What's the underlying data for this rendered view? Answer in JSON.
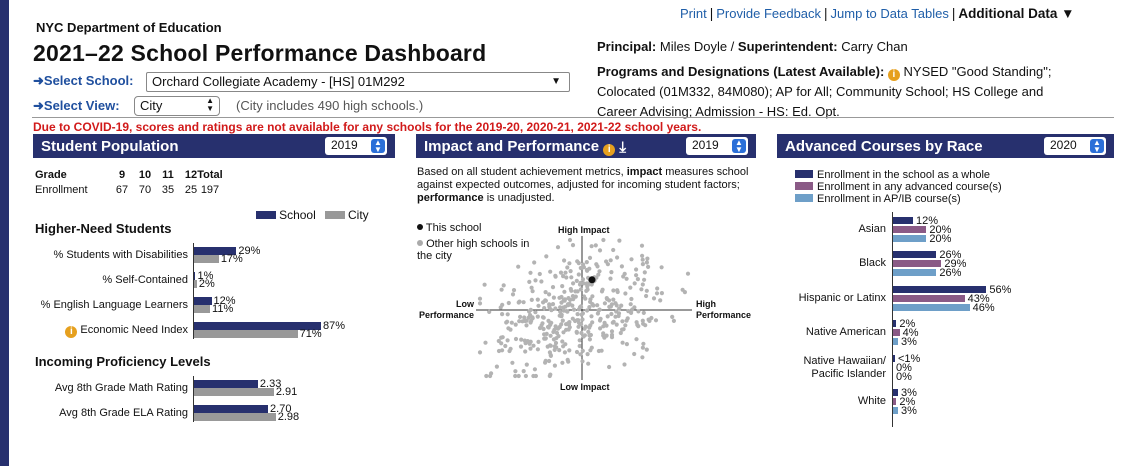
{
  "header": {
    "dept": "NYC Department of Education",
    "title": "2021–22 School Performance Dashboard",
    "links": [
      "Print",
      "Provide Feedback",
      "Jump to Data Tables"
    ],
    "additional_data": "Additional Data ▼",
    "select_school_label": "➜Select School:",
    "select_school_value": "Orchard Collegiate Academy - [HS] 01M292",
    "select_view_label": "➜Select View:",
    "select_view_value": "City",
    "city_note": "(City includes 490 high schools.)",
    "principal_label": "Principal:",
    "principal_value": "Miles Doyle",
    "superintendent_label": "Superintendent:",
    "superintendent_value": "Carry Chan",
    "programs_label": "Programs and Designations (Latest Available):",
    "programs_line1": "NYSED \"Good Standing\";",
    "programs_line2": "Colocated (01M332, 84M080); AP for All; Community School; HS College and",
    "programs_line3": "Career Advising; Admission - HS: Ed. Opt.",
    "covid_notice": "Due to COVID-19, scores and ratings are not available for any schools for the 2019-20, 2020-21, 2021-22 school years.",
    "icon_info": "info-icon",
    "icon_download": "download-icon"
  },
  "student_population": {
    "title": "Student Population",
    "year": "2019",
    "grade_label": "Grade",
    "grades": [
      "9",
      "10",
      "11",
      "12",
      "Total"
    ],
    "enroll_label": "Enrollment",
    "enrollment": [
      "67",
      "70",
      "35",
      "25",
      "197"
    ],
    "legend_school": "School",
    "legend_city": "City",
    "higher_need_title": "Higher-Need Students",
    "higher_need": [
      {
        "label": "% Students with Disabilities",
        "school": 29,
        "city": 17,
        "school_txt": "29%",
        "city_txt": "17%"
      },
      {
        "label": "% Self-Contained",
        "school": 1,
        "city": 2,
        "school_txt": "1%",
        "city_txt": "2%"
      },
      {
        "label": "% English Language Learners",
        "school": 12,
        "city": 11,
        "school_txt": "12%",
        "city_txt": "11%"
      },
      {
        "label": "Economic Need Index",
        "school": 87,
        "city": 71,
        "school_txt": "87%",
        "city_txt": "71%"
      }
    ],
    "proficiency_title": "Incoming Proficiency Levels",
    "proficiency": [
      {
        "label": "Avg 8th Grade Math Rating",
        "school": 2.33,
        "city": 2.91,
        "school_txt": "2.33",
        "city_txt": "2.91"
      },
      {
        "label": "Avg 8th Grade ELA Rating",
        "school": 2.7,
        "city": 2.98,
        "school_txt": "2.70",
        "city_txt": "2.98"
      }
    ]
  },
  "impact": {
    "title": "Impact and Performance",
    "year": "2019",
    "desc_1": "Based on all student achievement metrics,",
    "desc_impact": "impact",
    "desc_2": "measures school against expected outcomes, adjusted for incoming student factors;",
    "desc_performance": "performance",
    "desc_3": "is unadjusted.",
    "legend_this": "This school",
    "legend_other": "Other high schools in the city",
    "high_impact": "High Impact",
    "low_impact": "Low Impact",
    "low_perf": "Low Performance",
    "high_perf": "High Performance",
    "this_school_point": {
      "perf": 0.1,
      "impact": 0.55
    }
  },
  "advanced": {
    "title": "Advanced Courses by Race",
    "year": "2020",
    "legend": [
      {
        "label": "Enrollment in the school as a whole",
        "color": "#27306e"
      },
      {
        "label": "Enrollment in any advanced course(s)",
        "color": "#8a5a86"
      },
      {
        "label": "Enrollment in AP/IB course(s)",
        "color": "#6e9fc8"
      }
    ],
    "groups": [
      {
        "label": "Asian",
        "values": [
          12,
          20,
          20
        ],
        "texts": [
          "12%",
          "20%",
          "20%"
        ]
      },
      {
        "label": "Black",
        "values": [
          26,
          29,
          26
        ],
        "texts": [
          "26%",
          "29%",
          "26%"
        ]
      },
      {
        "label": "Hispanic or Latinx",
        "values": [
          56,
          43,
          46
        ],
        "texts": [
          "56%",
          "43%",
          "46%"
        ]
      },
      {
        "label": "Native American",
        "values": [
          2,
          4,
          3
        ],
        "texts": [
          "2%",
          "4%",
          "3%"
        ]
      },
      {
        "label": "Native Hawaiian/ Pacific Islander",
        "values": [
          0.5,
          0,
          0
        ],
        "texts": [
          "<1%",
          "0%",
          "0%"
        ]
      },
      {
        "label": "White",
        "values": [
          3,
          2,
          3
        ],
        "texts": [
          "3%",
          "2%",
          "3%"
        ]
      }
    ]
  },
  "colors": {
    "navy": "#27306e",
    "city_gray": "#999999",
    "covid_red": "#d11a1a",
    "link_blue": "#1f5ea8",
    "info_orange": "#e6a01e"
  }
}
